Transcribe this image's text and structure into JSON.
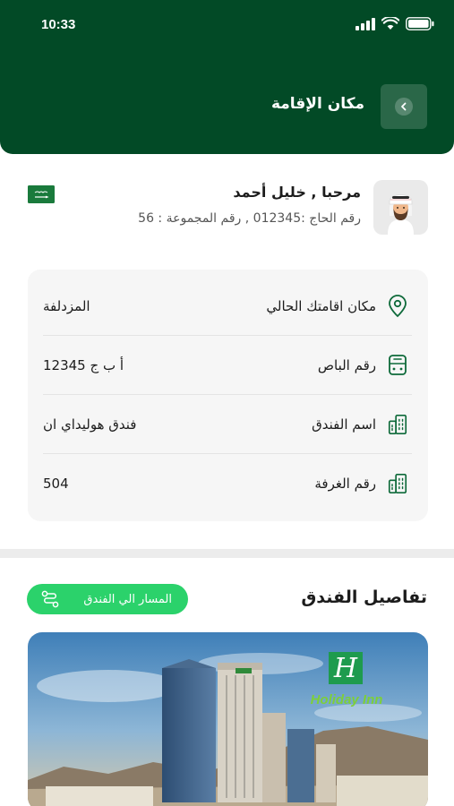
{
  "status_bar": {
    "time": "10:33"
  },
  "header": {
    "title": "مكان الإقامة"
  },
  "profile": {
    "greeting": "مرحبا , خليل أحمد",
    "info": "رقم الحاج :012345 , رقم المجموعة : 56"
  },
  "details": [
    {
      "label": "مكان اقامتك الحالي",
      "value": "المزدلفة",
      "icon": "location-pin-icon"
    },
    {
      "label": "رقم الباص",
      "value": "أ ب ج 12345",
      "icon": "bus-icon"
    },
    {
      "label": "اسم الفندق",
      "value": "فندق هوليداي ان",
      "icon": "building-icon"
    },
    {
      "label": "رقم الغرفة",
      "value": "504",
      "icon": "building-icon"
    }
  ],
  "hotel_section": {
    "title": "تفاصيل الفندق",
    "route_button": "المسار الي الفندق",
    "logo_text": "Holiday Inn"
  },
  "colors": {
    "header_bg": "#024a26",
    "accent_green": "#2bd26b",
    "icon_green": "#0e6a3a"
  }
}
